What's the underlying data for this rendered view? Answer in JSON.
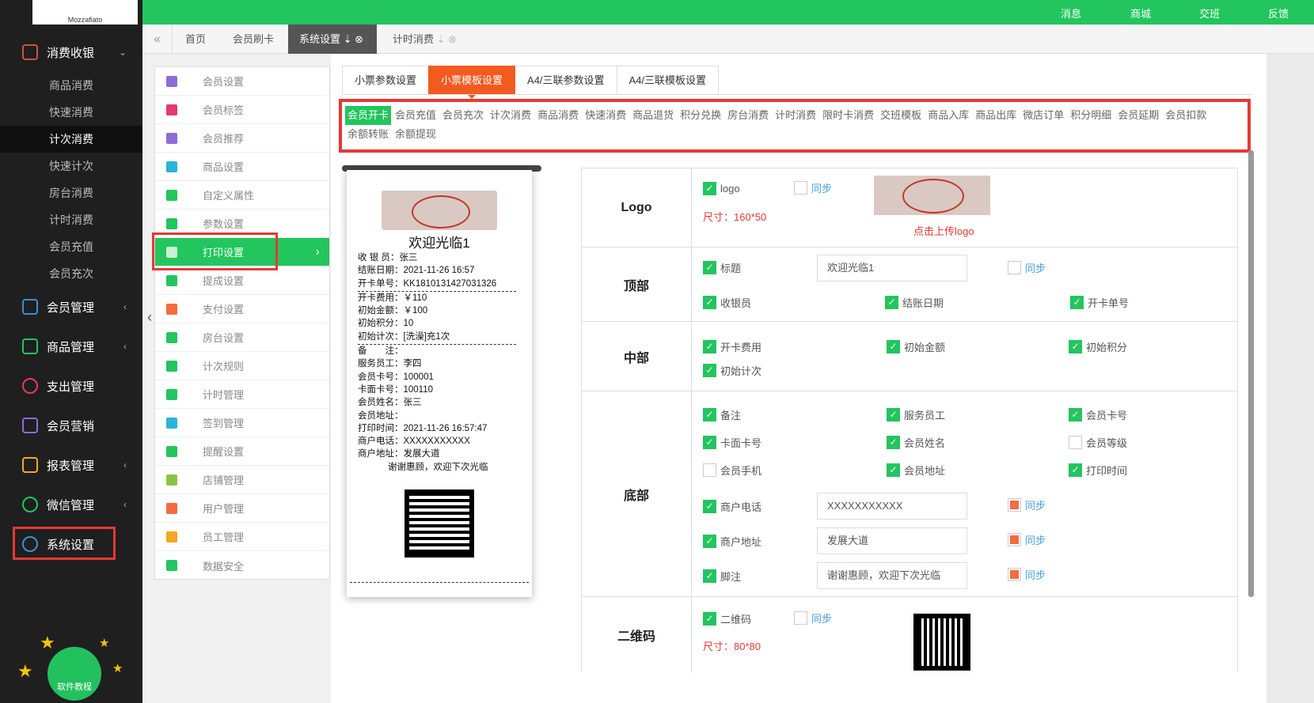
{
  "logo_text": "Mozzafiato",
  "sidebar": {
    "groups": [
      {
        "label": "消费收银",
        "arrow": "⌄"
      },
      {
        "label": "会员管理",
        "arrow": "‹"
      },
      {
        "label": "商品管理",
        "arrow": "‹"
      },
      {
        "label": "支出管理",
        "arrow": ""
      },
      {
        "label": "会员营销",
        "arrow": ""
      },
      {
        "label": "报表管理",
        "arrow": "‹"
      },
      {
        "label": "微信管理",
        "arrow": "‹"
      },
      {
        "label": "系统设置",
        "arrow": ""
      }
    ],
    "subitems": [
      "商品消费",
      "快速消费",
      "计次消费",
      "快速计次",
      "房台消费",
      "计时消费",
      "会员充值",
      "会员充次"
    ],
    "tutorial": "软件教程"
  },
  "topbar": {
    "items": [
      "消息",
      "商城",
      "交班",
      "反馈"
    ]
  },
  "tabs": [
    {
      "label": "首页"
    },
    {
      "label": "会员刷卡"
    },
    {
      "label": "系统设置"
    },
    {
      "label": "计时消费"
    }
  ],
  "settings_menu": [
    "会员设置",
    "会员标签",
    "会员推荐",
    "商品设置",
    "自定义属性",
    "参数设置",
    "打印设置",
    "提成设置",
    "支付设置",
    "房台设置",
    "计次规则",
    "计时管理",
    "签到管理",
    "提醒设置",
    "店铺管理",
    "用户管理",
    "员工管理",
    "数据安全"
  ],
  "subtabs": [
    "小票参数设置",
    "小票模板设置",
    "A4/三联参数设置",
    "A4/三联模板设置"
  ],
  "types": [
    "会员开卡",
    "会员充值",
    "会员充次",
    "计次消费",
    "商品消费",
    "快速消费",
    "商品退货",
    "积分兑换",
    "房台消费",
    "计时消费",
    "限时卡消费",
    "交班模板",
    "商品入库",
    "商品出库",
    "微店订单",
    "积分明细",
    "会员延期",
    "会员扣款",
    "余额转账",
    "余额提现"
  ],
  "receipt": {
    "title": "欢迎光临1",
    "lines1": [
      "收 银 员：张三",
      "结账日期：2021-11-26 16:57",
      "开卡单号：KK1810131427031326"
    ],
    "lines2": [
      "开卡费用：￥110",
      "初始金额：￥100",
      "初始积分：10",
      "初始计次：[洗澡]充1次"
    ],
    "lines3": [
      "备　　注：",
      "服务员工：李四",
      "会员卡号：100001",
      "卡面卡号：100110",
      "会员姓名：张三",
      "会员地址：",
      "打印时间：2021-11-26 16:57:47",
      "商户电话：XXXXXXXXXXX",
      "商户地址：发展大道"
    ],
    "thanks": "谢谢惠顾，欢迎下次光临"
  },
  "form": {
    "logo": {
      "label": "Logo",
      "cb": "logo",
      "sync": "同步",
      "size": "尺寸：160*50",
      "upload": "点击上传logo"
    },
    "top": {
      "label": "顶部",
      "title_cb": "标题",
      "title_val": "欢迎光临1",
      "sync": "同步",
      "cashier": "收银员",
      "date": "结账日期",
      "cardno": "开卡单号"
    },
    "middle": {
      "label": "中部",
      "fee": "开卡费用",
      "amount": "初始金额",
      "points": "初始积分",
      "times": "初始计次"
    },
    "bottom": {
      "label": "底部",
      "remark": "备注",
      "staff": "服务员工",
      "cardnum": "会员卡号",
      "facecard": "卡面卡号",
      "name": "会员姓名",
      "level": "会员等级",
      "phone": "会员手机",
      "address": "会员地址",
      "printtime": "打印时间",
      "shopphone": "商户电话",
      "shopphone_val": "XXXXXXXXXXX",
      "shopaddr": "商户地址",
      "shopaddr_val": "发展大道",
      "footer": "脚注",
      "footer_val": "谢谢惠顾，欢迎下次光临",
      "sync": "同步"
    },
    "qr": {
      "label": "二维码",
      "cb": "二维码",
      "sync": "同步",
      "size": "尺寸：80*80"
    }
  }
}
